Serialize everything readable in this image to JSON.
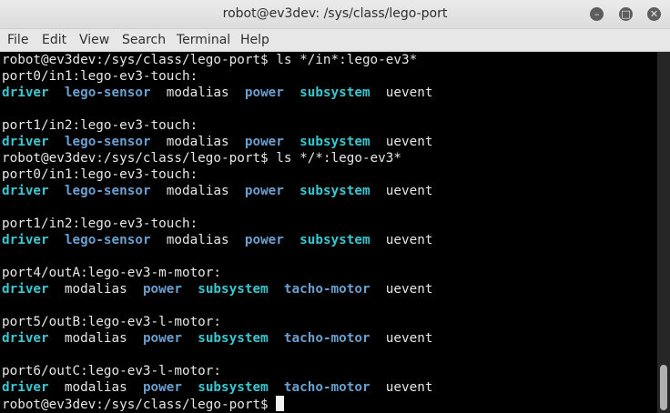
{
  "window": {
    "title": "robot@ev3dev: /sys/class/lego-port"
  },
  "controls": {
    "minimize": "–",
    "maximize": "□",
    "close": "✕"
  },
  "menu": [
    "File",
    "Edit",
    "View",
    "Search",
    "Terminal",
    "Help"
  ],
  "colors": {
    "dir": "#6a9fcf",
    "link": "#3bc6d0",
    "text": "#e6e6e6",
    "background": "#000000"
  },
  "lines": [
    [
      [
        "t",
        "robot@ev3dev:/sys/class/lego-port$ ls */in*:lego-ev3*"
      ]
    ],
    [
      [
        "t",
        "port0/in1:lego-ev3-touch:"
      ]
    ],
    [
      [
        "c",
        "driver"
      ],
      [
        "t",
        "  "
      ],
      [
        "b",
        "lego-sensor"
      ],
      [
        "t",
        "  modalias  "
      ],
      [
        "b",
        "power"
      ],
      [
        "t",
        "  "
      ],
      [
        "c",
        "subsystem"
      ],
      [
        "t",
        "  uevent"
      ]
    ],
    [],
    [
      [
        "t",
        "port1/in2:lego-ev3-touch:"
      ]
    ],
    [
      [
        "c",
        "driver"
      ],
      [
        "t",
        "  "
      ],
      [
        "b",
        "lego-sensor"
      ],
      [
        "t",
        "  modalias  "
      ],
      [
        "b",
        "power"
      ],
      [
        "t",
        "  "
      ],
      [
        "c",
        "subsystem"
      ],
      [
        "t",
        "  uevent"
      ]
    ],
    [
      [
        "t",
        "robot@ev3dev:/sys/class/lego-port$ ls */*:lego-ev3*"
      ]
    ],
    [
      [
        "t",
        "port0/in1:lego-ev3-touch:"
      ]
    ],
    [
      [
        "c",
        "driver"
      ],
      [
        "t",
        "  "
      ],
      [
        "b",
        "lego-sensor"
      ],
      [
        "t",
        "  modalias  "
      ],
      [
        "b",
        "power"
      ],
      [
        "t",
        "  "
      ],
      [
        "c",
        "subsystem"
      ],
      [
        "t",
        "  uevent"
      ]
    ],
    [],
    [
      [
        "t",
        "port1/in2:lego-ev3-touch:"
      ]
    ],
    [
      [
        "c",
        "driver"
      ],
      [
        "t",
        "  "
      ],
      [
        "b",
        "lego-sensor"
      ],
      [
        "t",
        "  modalias  "
      ],
      [
        "b",
        "power"
      ],
      [
        "t",
        "  "
      ],
      [
        "c",
        "subsystem"
      ],
      [
        "t",
        "  uevent"
      ]
    ],
    [],
    [
      [
        "t",
        "port4/outA:lego-ev3-m-motor:"
      ]
    ],
    [
      [
        "c",
        "driver"
      ],
      [
        "t",
        "  modalias  "
      ],
      [
        "b",
        "power"
      ],
      [
        "t",
        "  "
      ],
      [
        "c",
        "subsystem"
      ],
      [
        "t",
        "  "
      ],
      [
        "b",
        "tacho-motor"
      ],
      [
        "t",
        "  uevent"
      ]
    ],
    [],
    [
      [
        "t",
        "port5/outB:lego-ev3-l-motor:"
      ]
    ],
    [
      [
        "c",
        "driver"
      ],
      [
        "t",
        "  modalias  "
      ],
      [
        "b",
        "power"
      ],
      [
        "t",
        "  "
      ],
      [
        "c",
        "subsystem"
      ],
      [
        "t",
        "  "
      ],
      [
        "b",
        "tacho-motor"
      ],
      [
        "t",
        "  uevent"
      ]
    ],
    [],
    [
      [
        "t",
        "port6/outC:lego-ev3-l-motor:"
      ]
    ],
    [
      [
        "c",
        "driver"
      ],
      [
        "t",
        "  modalias  "
      ],
      [
        "b",
        "power"
      ],
      [
        "t",
        "  "
      ],
      [
        "c",
        "subsystem"
      ],
      [
        "t",
        "  "
      ],
      [
        "b",
        "tacho-motor"
      ],
      [
        "t",
        "  uevent"
      ]
    ],
    [
      [
        "t",
        "robot@ev3dev:/sys/class/lego-port$ "
      ]
    ]
  ]
}
